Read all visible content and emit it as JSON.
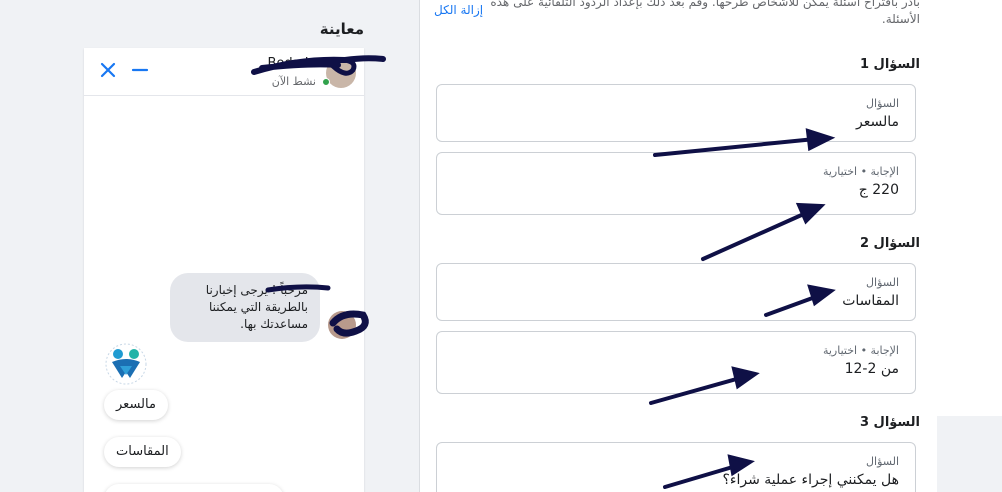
{
  "preview": {
    "title": "معاينة",
    "chat": {
      "name": "Boda L",
      "status": "نشط الآن",
      "greeting": "مرحباً ! يرجى إخبارنا بالطريقة التي يمكننا مساعدتك بها.",
      "quick_replies": [
        "مالسعر",
        "المقاسات"
      ]
    }
  },
  "form": {
    "intro_line1": "بادر باقتراح أسئلة يمكن للأشخاص طرحها. وقم بعد ذلك بإعداد الردود التلقائية على هذه",
    "intro_line2": "الأسئلة.",
    "remove_all": "إزالة الكل",
    "question_label": "السؤال",
    "answer_label": "الإجابة • اختيارية",
    "questions": [
      {
        "heading": "السؤال 1",
        "question": "مالسعر",
        "answer": "220 ج"
      },
      {
        "heading": "السؤال 2",
        "question": "المقاسات",
        "answer": "من 2-12"
      },
      {
        "heading": "السؤال 3",
        "question": "هل يمكنني إجراء عملية شراء؟",
        "answer": ""
      }
    ]
  },
  "colors": {
    "accent": "#1877f2",
    "arrow": "#0f1046",
    "online": "#31a24c"
  }
}
